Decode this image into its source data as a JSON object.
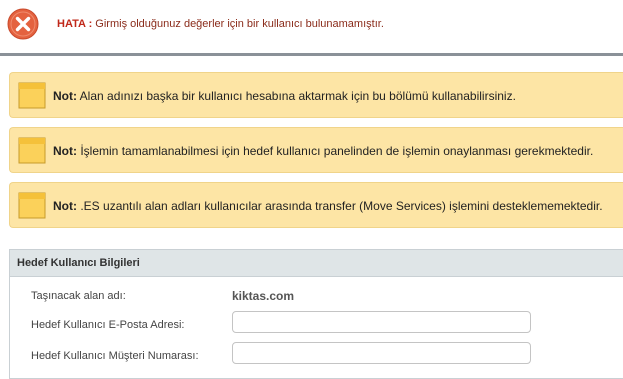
{
  "error": {
    "icon": "error-x-icon",
    "label": "HATA :",
    "message": "Girmiş olduğunuz değerler için bir kullanıcı bulunamamıştır.",
    "colors": {
      "icon_fill": "#e4623f",
      "text": "#c0281a"
    }
  },
  "notes": [
    {
      "icon": "sticky-note-icon",
      "label": "Not:",
      "text": "Alan adınızı başka bir kullanıcı hesabına aktarmak için bu bölümü kullanabilirsiniz."
    },
    {
      "icon": "sticky-note-icon",
      "label": "Not:",
      "text": "İşlemin tamamlanabilmesi için hedef kullanıcı panelinden de işlemin onaylanması gerekmektedir."
    },
    {
      "icon": "sticky-note-icon",
      "label": "Not:",
      "text": ".ES uzantılı alan adları kullanıcılar arasında transfer (Move Services) işlemini desteklememektedir."
    }
  ],
  "panel": {
    "title": "Hedef Kullanıcı Bilgileri",
    "domain_label": "Taşınacak alan adı:",
    "domain_value": "kiktas.com",
    "email_label": "Hedef Kullanıcı E-Posta Adresi:",
    "email_value": "",
    "customer_label": "Hedef Kullanıcı Müşteri Numarası:",
    "customer_value": ""
  }
}
